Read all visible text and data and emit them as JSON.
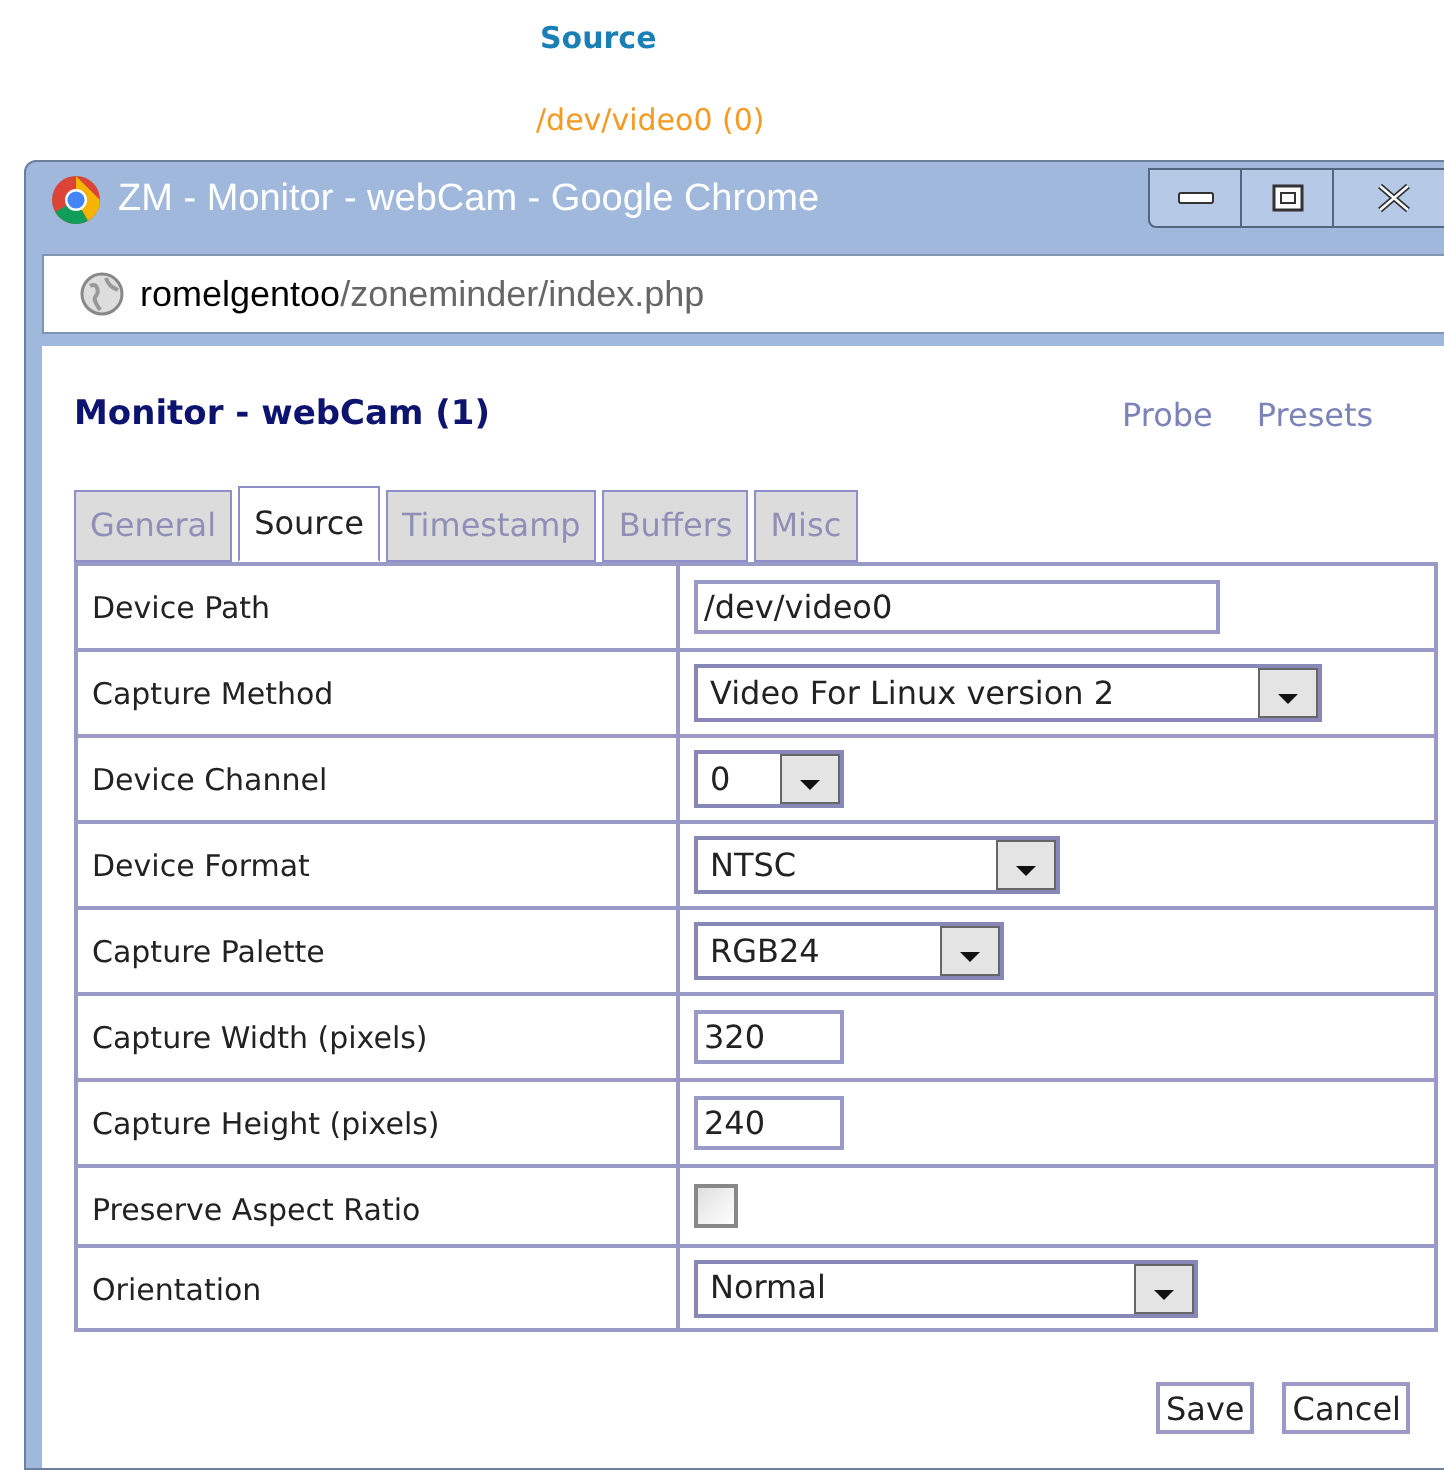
{
  "page_heading": "Source",
  "device_label": "/dev/video0 (0)",
  "window": {
    "title": "ZM - Monitor - webCam - Google Chrome"
  },
  "address_bar": {
    "host": "romelgentoo",
    "path": "/zoneminder/index.php"
  },
  "monitor_title": "Monitor - webCam (1)",
  "links": [
    "Probe",
    "Presets"
  ],
  "tabs": [
    {
      "label": "General",
      "selected": false
    },
    {
      "label": "Source",
      "selected": true
    },
    {
      "label": "Timestamp",
      "selected": false
    },
    {
      "label": "Buffers",
      "selected": false
    },
    {
      "label": "Misc",
      "selected": false
    }
  ],
  "fields": [
    {
      "label": "Device Path",
      "kind": "input",
      "value": "/dev/video0"
    },
    {
      "label": "Capture Method",
      "kind": "select",
      "value": "Video For Linux version 2"
    },
    {
      "label": "Device Channel",
      "kind": "select",
      "value": "0"
    },
    {
      "label": "Device Format",
      "kind": "select",
      "value": "NTSC"
    },
    {
      "label": "Capture Palette",
      "kind": "select",
      "value": "RGB24"
    },
    {
      "label": "Capture Width (pixels)",
      "kind": "input",
      "value": "320"
    },
    {
      "label": "Capture Height (pixels)",
      "kind": "input",
      "value": "240"
    },
    {
      "label": "Preserve Aspect Ratio",
      "kind": "checkbox",
      "checked": false
    },
    {
      "label": "Orientation",
      "kind": "select",
      "value": "Normal"
    }
  ],
  "buttons": [
    "Save",
    "Cancel"
  ]
}
